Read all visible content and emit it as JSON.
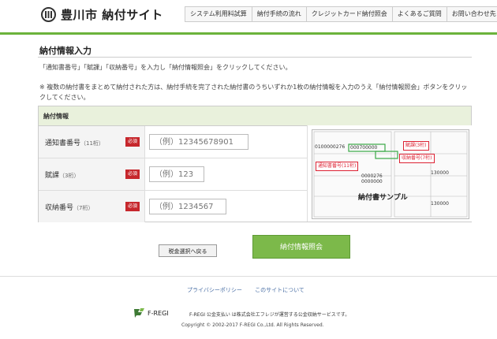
{
  "header": {
    "logo_text": "豊川市 納付サイト",
    "nav": [
      "システム利用料試算",
      "納付手続の流れ",
      "クレジットカード納付照会",
      "よくあるご質問",
      "お問い合わせ先"
    ]
  },
  "page": {
    "title": "納付情報入力",
    "desc1": "「通知書番号」「賦課」「収納番号」を入力し「納付情報照会」をクリックしてください。",
    "desc2": "※ 複数の納付書をまとめて納付された方は、納付手続を完了された納付書のうちいずれか1枚の納付情報を入力のうえ「納付情報照会」ボタンをクリックしてください。"
  },
  "form": {
    "section_title": "納付情報",
    "required_label": "必須",
    "fields": [
      {
        "label": "通知書番号",
        "hint": "（11桁）",
        "placeholder": "（例）12345678901"
      },
      {
        "label": "賦課",
        "hint": "（3桁）",
        "placeholder": "（例）123"
      },
      {
        "label": "収納番号",
        "hint": "（7桁）",
        "placeholder": "（例）1234567"
      }
    ],
    "sample": {
      "caption": "納付書サンプル",
      "callout_fuka": "賦課(3桁)",
      "callout_shuno": "収納番号(7桁)",
      "callout_tsuchi": "通知書番号(11桁)",
      "num1": "0100000276",
      "num2": "000700000",
      "num3": "0000276",
      "num4": "0000000",
      "amount1": "130000",
      "amount2": "130000"
    }
  },
  "buttons": {
    "back": "税金選択へ戻る",
    "submit": "納付情報照会"
  },
  "footer": {
    "links": [
      "プライバシーポリシー",
      "このサイトについて"
    ],
    "brand": "F-REGI",
    "service_text": "F-REGI 公金支払い は株式会社エフレジが運営する公金収納サービスです。",
    "copyright": "Copyright © 2002-2017 F-REGI Co.,Ltd. All Rights Reserved."
  },
  "colors": {
    "accent": "#6bb33b",
    "required": "#c6272c",
    "button": "#7cb94a"
  }
}
